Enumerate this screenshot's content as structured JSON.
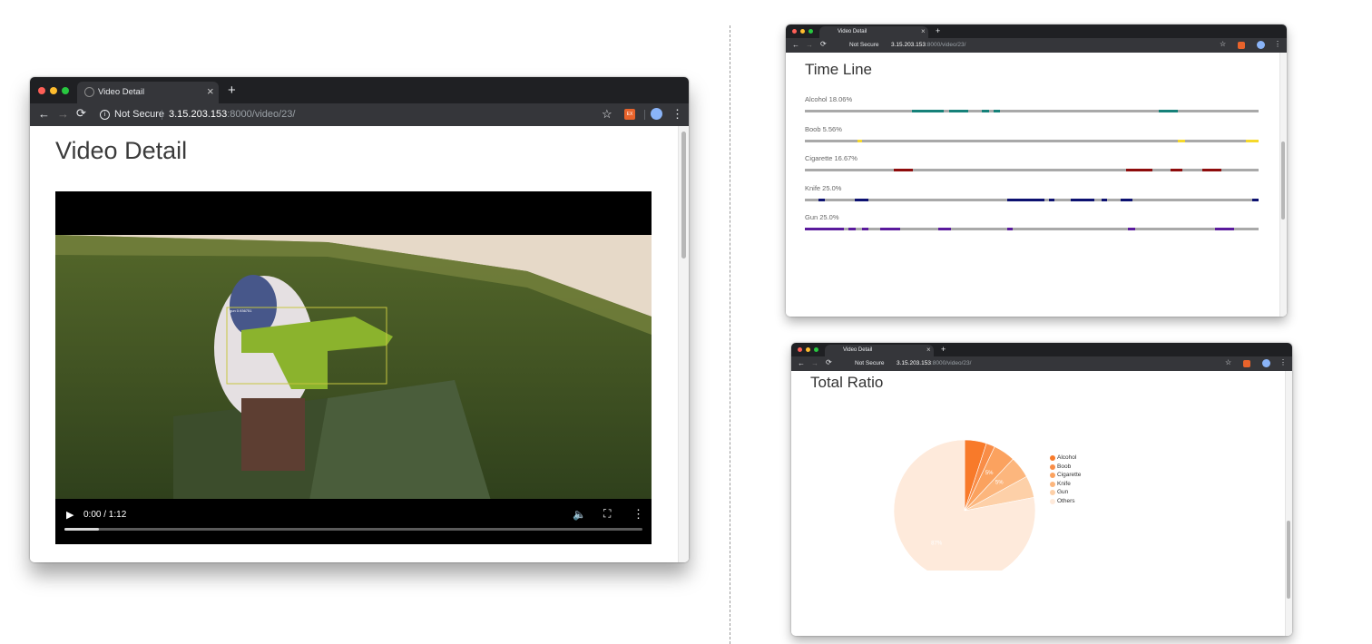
{
  "windows": [
    {
      "tab_title": "Video Detail",
      "tab_close": "×",
      "new_tab": "+",
      "security": "Not Secure",
      "url_host": "3.15.203.153",
      "url_path": ":8000/video/23/",
      "ext_label": "EX"
    },
    {
      "tab_title": "Video Detail",
      "tab_close": "×",
      "new_tab": "+",
      "security": "Not Secure",
      "url_host": "3.15.203.153",
      "url_path": ":8000/video/23/",
      "ext_label": "EX"
    },
    {
      "tab_title": "Video Detail",
      "tab_close": "×",
      "new_tab": "+",
      "security": "Not Secure",
      "url_host": "3.15.203.153",
      "url_path": ":8000/video/23/",
      "ext_label": "EX"
    }
  ],
  "video_page": {
    "title": "Video Detail",
    "time_display": "0:00 / 1:12",
    "progress_fraction": 0.06,
    "detection_label": "gun 0.936751"
  },
  "timeline": {
    "title": "Time Line",
    "rows": [
      {
        "label": "Alcohol 18.06%",
        "color": "#168179",
        "segments": [
          [
            0.235,
            0.305
          ],
          [
            0.318,
            0.36
          ],
          [
            0.39,
            0.405
          ],
          [
            0.416,
            0.43
          ],
          [
            0.78,
            0.822
          ]
        ]
      },
      {
        "label": "Boob 5.56%",
        "color": "#f5d82a",
        "segments": [
          [
            0.115,
            0.126
          ],
          [
            0.822,
            0.838
          ],
          [
            0.972,
            1.0
          ]
        ]
      },
      {
        "label": "Cigarette 16.67%",
        "color": "#8e0c0c",
        "segments": [
          [
            0.195,
            0.237
          ],
          [
            0.708,
            0.765
          ],
          [
            0.805,
            0.832
          ],
          [
            0.875,
            0.918
          ]
        ]
      },
      {
        "label": "Knife 25.0%",
        "color": "#0c1170",
        "segments": [
          [
            0.03,
            0.044
          ],
          [
            0.11,
            0.14
          ],
          [
            0.445,
            0.528
          ],
          [
            0.538,
            0.55
          ],
          [
            0.585,
            0.638
          ],
          [
            0.653,
            0.666
          ],
          [
            0.696,
            0.722
          ],
          [
            0.985,
            1.0
          ]
        ]
      },
      {
        "label": "Gun 25.0%",
        "color": "#5a1a9c",
        "segments": [
          [
            0.0,
            0.085
          ],
          [
            0.095,
            0.112
          ],
          [
            0.125,
            0.14
          ],
          [
            0.165,
            0.21
          ],
          [
            0.293,
            0.322
          ],
          [
            0.445,
            0.458
          ],
          [
            0.712,
            0.727
          ],
          [
            0.903,
            0.945
          ]
        ]
      }
    ]
  },
  "ratio": {
    "title": "Total Ratio",
    "chart_data": {
      "type": "pie",
      "categories": [
        "Alcohol",
        "Boob",
        "Cigarette",
        "Knife",
        "Gun",
        "Others"
      ],
      "values": [
        5,
        2,
        5,
        5,
        5,
        78
      ],
      "colors": [
        "#f87a2a",
        "#f98d47",
        "#fba25f",
        "#fcb67d",
        "#fdd0a8",
        "#feeadb"
      ],
      "data_labels": [
        "",
        "",
        "5%",
        "5%",
        "",
        "87%"
      ],
      "legend_position": "right"
    }
  }
}
